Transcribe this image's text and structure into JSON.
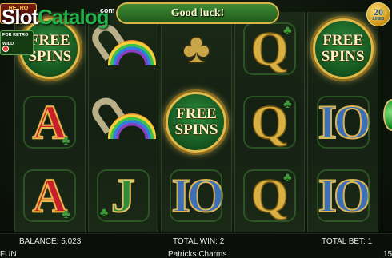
{
  "header": {
    "message": "Good luck!",
    "lines_count": "20",
    "lines_label": "LINES"
  },
  "watermark": {
    "part1": "Slot",
    "part2": "Catalog",
    "suffix": "com"
  },
  "promo": {
    "retro_line1": "RETRO",
    "retro_line2": "B",
    "text_line1": "FOR RETRO",
    "text_line2": "WILD"
  },
  "reels": [
    [
      {
        "symbol": "free-spins",
        "text1": "FREE",
        "text2": "SPINS"
      },
      {
        "symbol": "letter-a",
        "text": "A"
      },
      {
        "symbol": "letter-a",
        "text": "A"
      }
    ],
    [
      {
        "symbol": "horseshoe-rainbow"
      },
      {
        "symbol": "horseshoe-rainbow"
      },
      {
        "symbol": "letter-j",
        "text": "J"
      }
    ],
    [
      {
        "symbol": "clover"
      },
      {
        "symbol": "free-spins",
        "text1": "FREE",
        "text2": "SPINS"
      },
      {
        "symbol": "letter-10",
        "text": "IO"
      }
    ],
    [
      {
        "symbol": "letter-q",
        "text": "Q"
      },
      {
        "symbol": "letter-q",
        "text": "Q"
      },
      {
        "symbol": "letter-q",
        "text": "Q"
      }
    ],
    [
      {
        "symbol": "free-spins",
        "text1": "FREE",
        "text2": "SPINS"
      },
      {
        "symbol": "letter-10",
        "text": "IO"
      },
      {
        "symbol": "letter-10",
        "text": "IO"
      }
    ]
  ],
  "footer": {
    "balance": "BALANCE: 5,023",
    "total_win": "TOTAL WIN: 2",
    "total_bet": "TOTAL BET: 1",
    "mode": "FUN",
    "game_title": "Patricks Charms",
    "right_value": "15"
  },
  "colors": {
    "accent_gold": "#d9b44a",
    "message_bar": "#2f7a28",
    "brand_green": "#23b24a"
  }
}
